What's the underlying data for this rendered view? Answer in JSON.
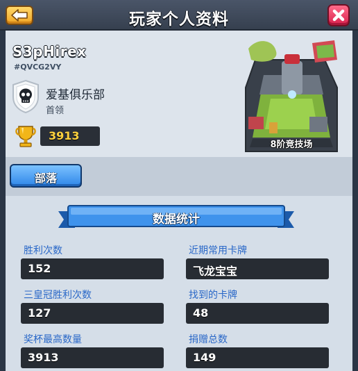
{
  "header": {
    "title": "玩家个人资料"
  },
  "player": {
    "name": "S3pHirex",
    "tag": "#QVCG2VY",
    "clan_name": "爱基俱乐部",
    "clan_role": "首领",
    "trophies": "3913"
  },
  "arena": {
    "label": "8阶竞技场"
  },
  "tribe_button": {
    "label": "部落"
  },
  "stats": {
    "section_title": "数据统计",
    "items": [
      {
        "label": "胜利次数",
        "value": "152"
      },
      {
        "label": "近期常用卡牌",
        "value": "飞龙宝宝"
      },
      {
        "label": "三皇冠胜利次数",
        "value": "127"
      },
      {
        "label": "找到的卡牌",
        "value": "48"
      },
      {
        "label": "奖杯最高数量",
        "value": "3913"
      },
      {
        "label": "捐赠总数",
        "value": "149"
      }
    ]
  },
  "colors": {
    "stat_label": "#2a68c8",
    "trophy_text": "#ffd23e",
    "tribe_button": "#2e86e8",
    "close_button": "#d9224e",
    "back_button": "#f0a524"
  },
  "icons": {
    "back": "back-arrow-icon",
    "close": "close-x-icon",
    "clan": "skull-shield-icon",
    "trophy": "trophy-icon",
    "arena": "arena-icon"
  }
}
